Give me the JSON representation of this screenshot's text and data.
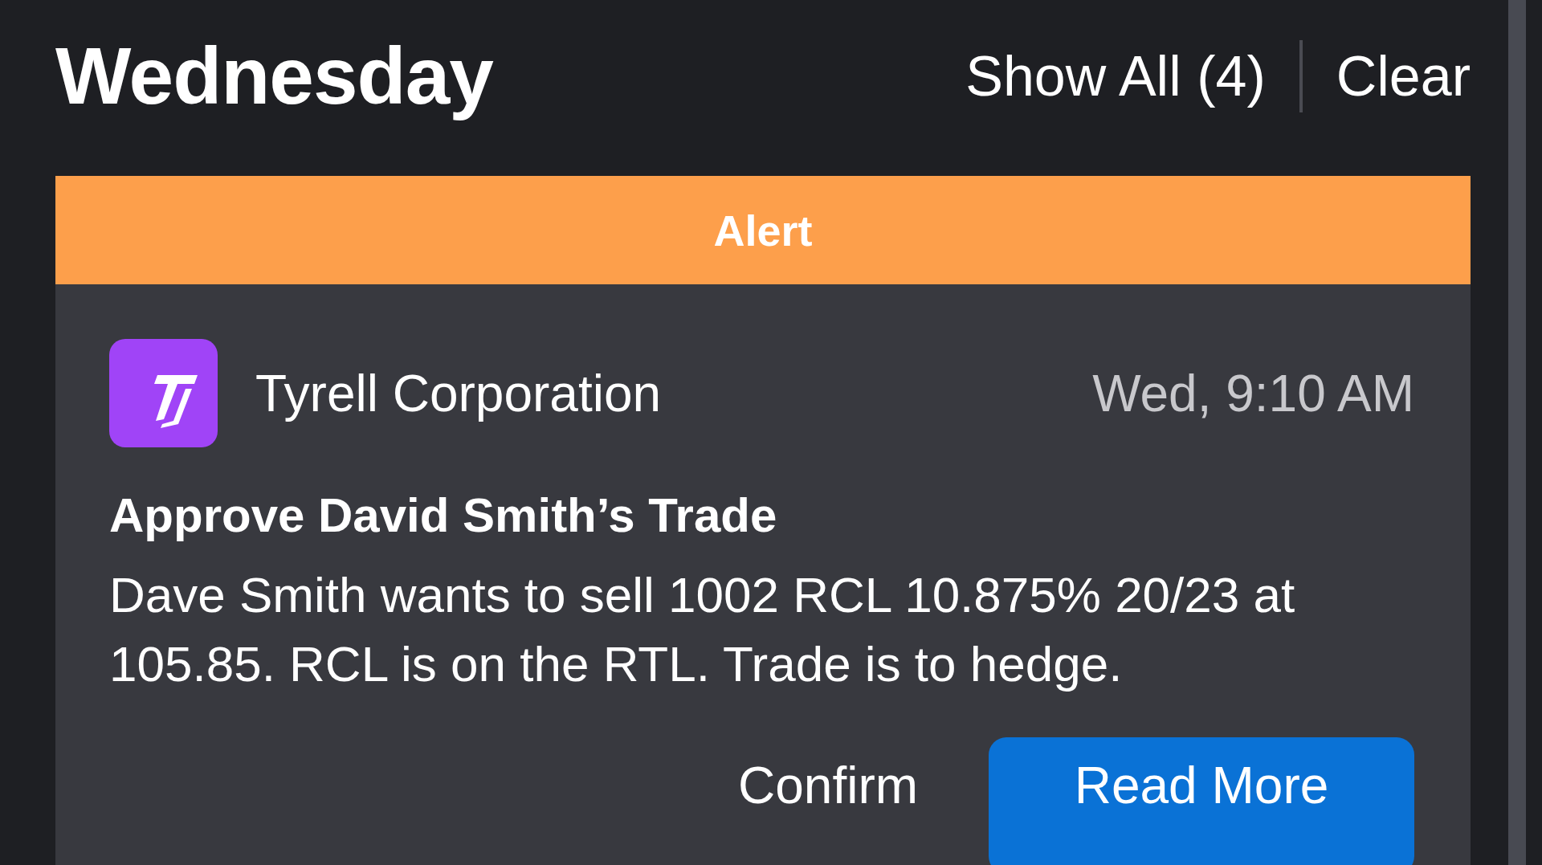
{
  "header": {
    "title": "Wednesday",
    "show_all": "Show All (4)",
    "clear": "Clear"
  },
  "notification": {
    "banner": "Alert",
    "sender": "Tyrell Corporation",
    "time": "Wed, 9:10 AM",
    "heading": "Approve David Smith’s Trade",
    "body": "Dave Smith wants to sell 1002 RCL 10.875% 20/23 at 105.85. RCL is on the RTL. Trade is to hedge.",
    "buttons": [
      {
        "label": "Confirm",
        "kind": "plain"
      },
      {
        "label": "Read More",
        "kind": "primary"
      }
    ]
  }
}
